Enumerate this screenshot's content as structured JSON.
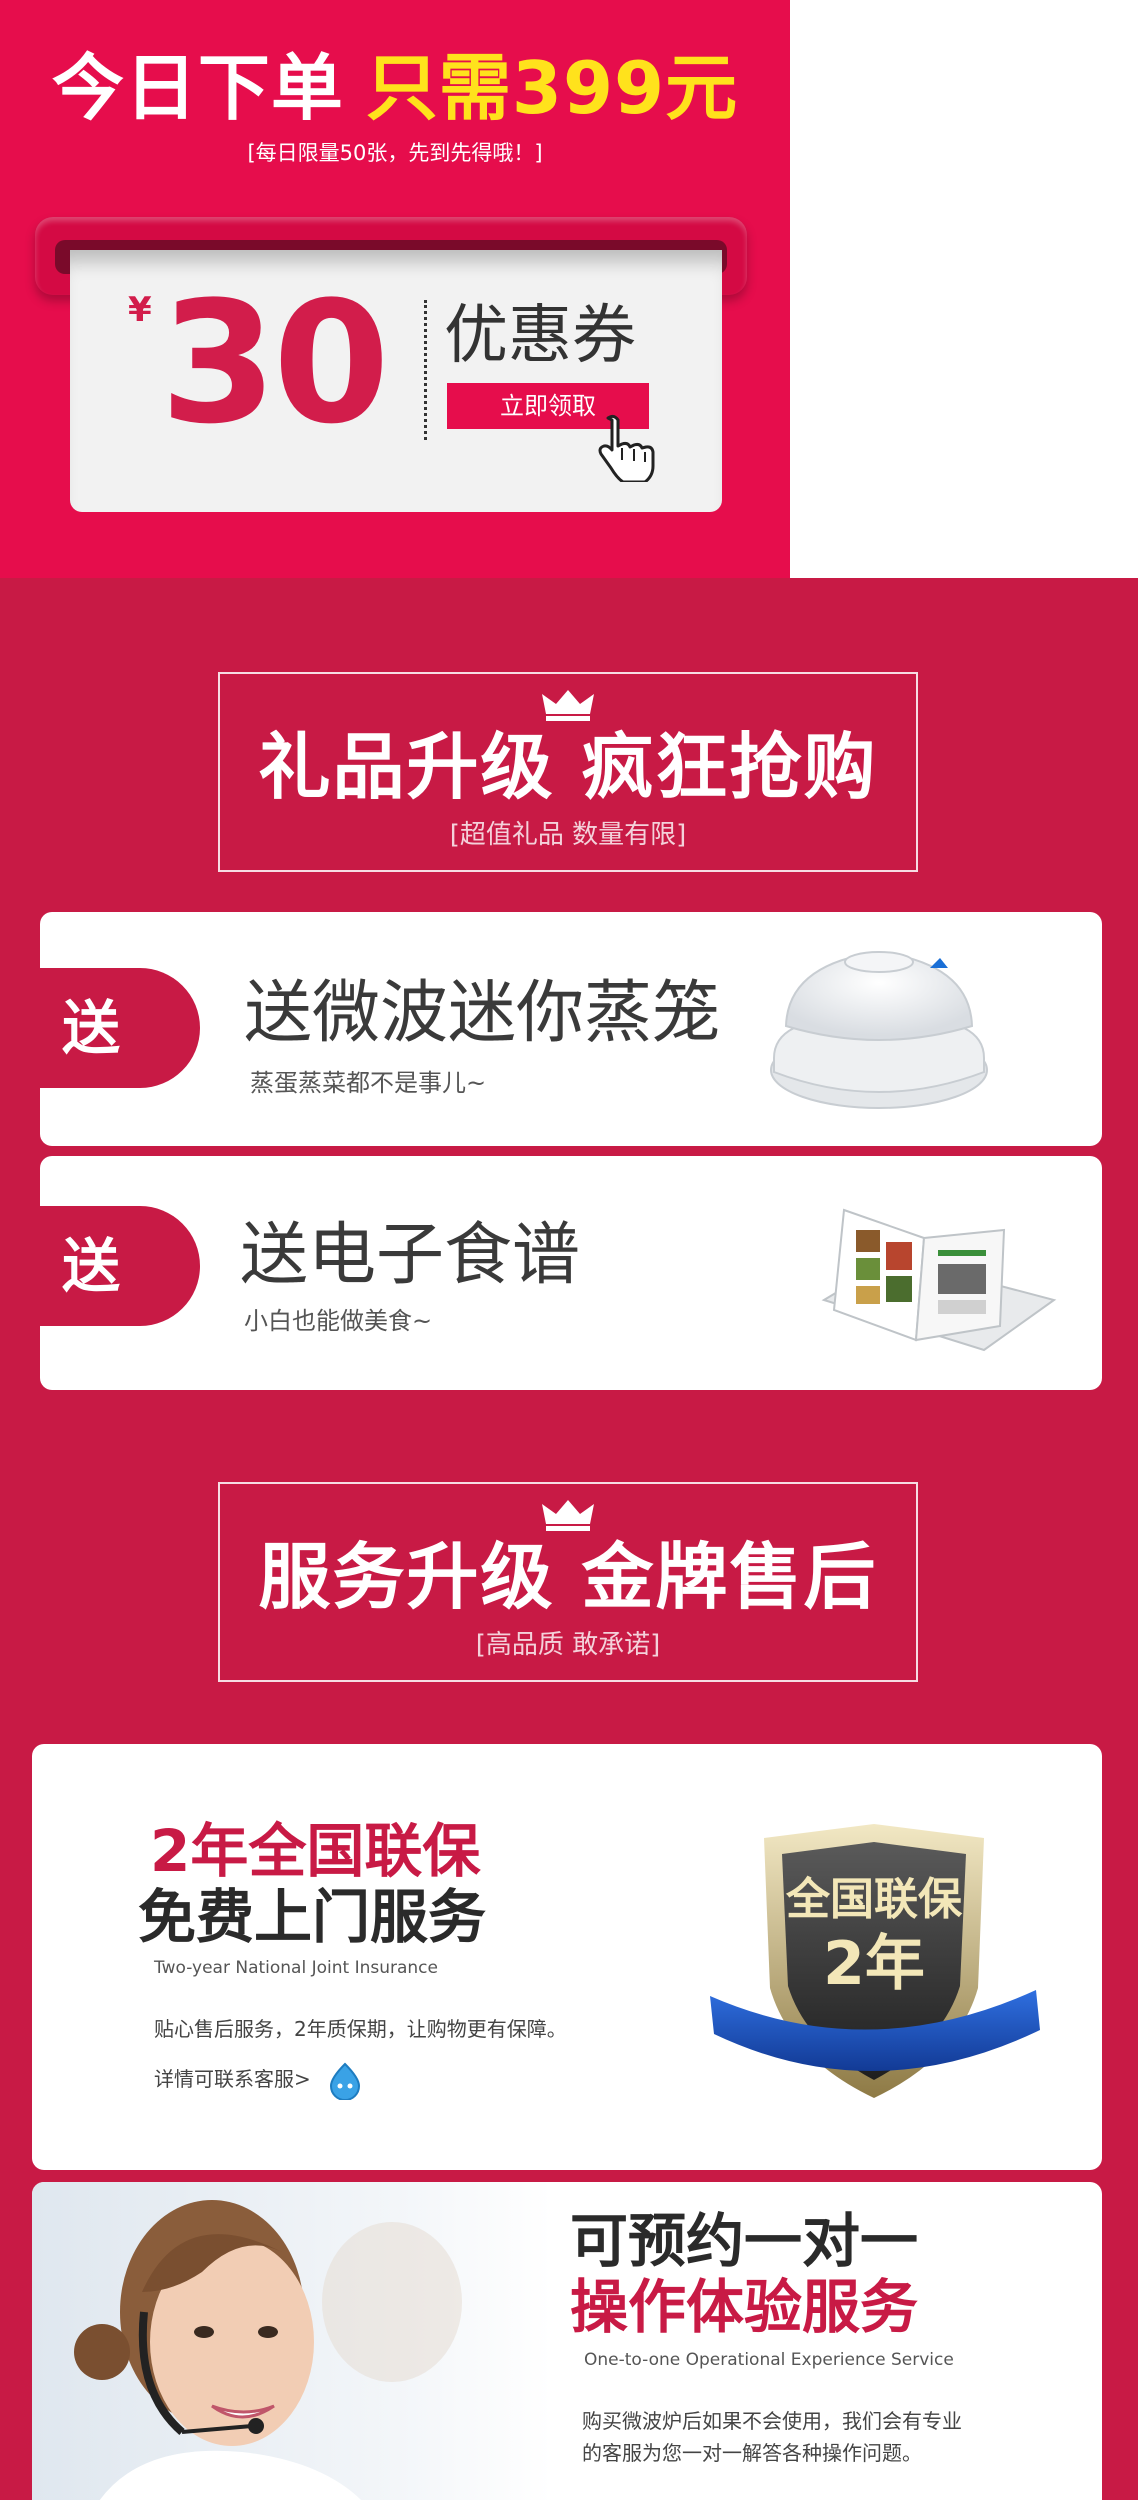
{
  "promo": {
    "headline_white": "今日下单",
    "headline_yellow": "只需399元",
    "sub_headline": "[每日限量50张，先到先得哦！]"
  },
  "coupon": {
    "currency_symbol": "¥",
    "amount": "30",
    "title": "优惠券",
    "claim_label": "立即领取"
  },
  "gift_section": {
    "title": "礼品升级 疯狂抢购",
    "subtitle": "[超值礼品 数量有限]",
    "items": [
      {
        "badge": "送",
        "title": "送微波迷你蒸笼",
        "subtitle": "蒸蛋蒸菜都不是事儿~",
        "image": "steamer-image"
      },
      {
        "badge": "送",
        "title": "送电子食谱",
        "subtitle": "小白也能做美食~",
        "image": "recipe-book-image"
      }
    ]
  },
  "service_section": {
    "title": "服务升级 金牌售后",
    "subtitle": "[高品质 敢承诺]",
    "warranty": {
      "title_red": "2年全国联保",
      "title_dark": "免费上门服务",
      "title_en": "Two-year National Joint Insurance",
      "description": "贴心售后服务，2年质保期，让购物更有保障。",
      "contact_link": "详情可联系客服>",
      "shield_line1": "全国联保",
      "shield_line2": "2年"
    },
    "experience": {
      "title_dark": "可预约一对一",
      "title_red": "操作体验服务",
      "title_en": "One-to-one Operational Experience Service",
      "description_line1": "购买微波炉后如果不会使用，我们会有专业",
      "description_line2": "的客服为您一对一解答各种操作问题。"
    }
  },
  "colors": {
    "banner_red": "#e60d4c",
    "section_red": "#c81a45",
    "highlight_yellow": "#ffe21c"
  }
}
